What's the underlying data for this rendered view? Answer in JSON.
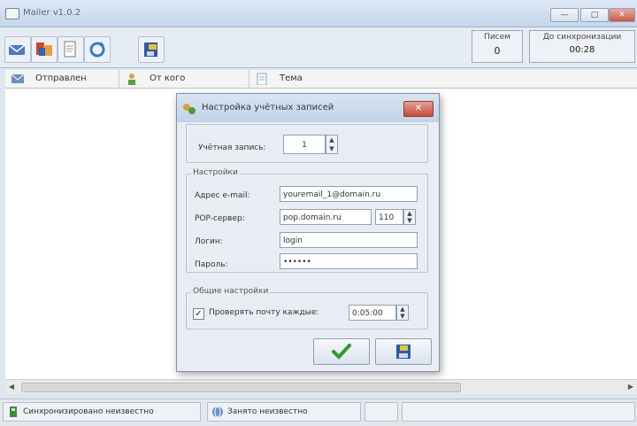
{
  "window": {
    "title": "Mailer v1.0.2",
    "min_label": "—",
    "max_label": "□",
    "close_label": "✕"
  },
  "toolbar": {
    "buttons": [
      {
        "name": "send-receive-icon"
      },
      {
        "name": "new-mail-icon"
      },
      {
        "name": "accounts-icon"
      },
      {
        "name": "refresh-icon"
      },
      {
        "name": "exit-icon"
      }
    ],
    "counter": {
      "label": "Писем",
      "value": "0"
    },
    "sync": {
      "label": "До синхронизации",
      "value": "00:28"
    }
  },
  "list": {
    "columns": [
      {
        "label": "Отправлен",
        "icon": "sent-icon"
      },
      {
        "label": "От кого",
        "icon": "sender-icon"
      },
      {
        "label": "Тема",
        "icon": "subject-icon"
      }
    ]
  },
  "statusbar": {
    "sync_status": "Синхронизировано неизвестно",
    "check_status": "Занято неизвестно"
  },
  "dialog": {
    "title": "Настройка учётных записей",
    "close_label": "✕",
    "account_label": "Учётная запись:",
    "account_value": "1",
    "settings_legend": "Настройки",
    "email_label": "Адрес e-mail:",
    "email_value": "youremail_1@domain.ru",
    "pop_label": "POP-сервер:",
    "pop_value": "pop.domain.ru",
    "port_value": "110",
    "login_label": "Логин:",
    "login_value": "login",
    "password_label": "Пароль:",
    "password_value": "••••••",
    "general_legend": "Общие настройки",
    "check_label": "Проверять почту каждые:",
    "check_checked": true,
    "interval_value": "0:05:00",
    "ok_icon": "checkmark-icon",
    "save_icon": "save-icon"
  },
  "colors": {
    "accent": "#3f6fb5",
    "title_bg": "#c6d6ea",
    "close_red": "#c9574a"
  }
}
